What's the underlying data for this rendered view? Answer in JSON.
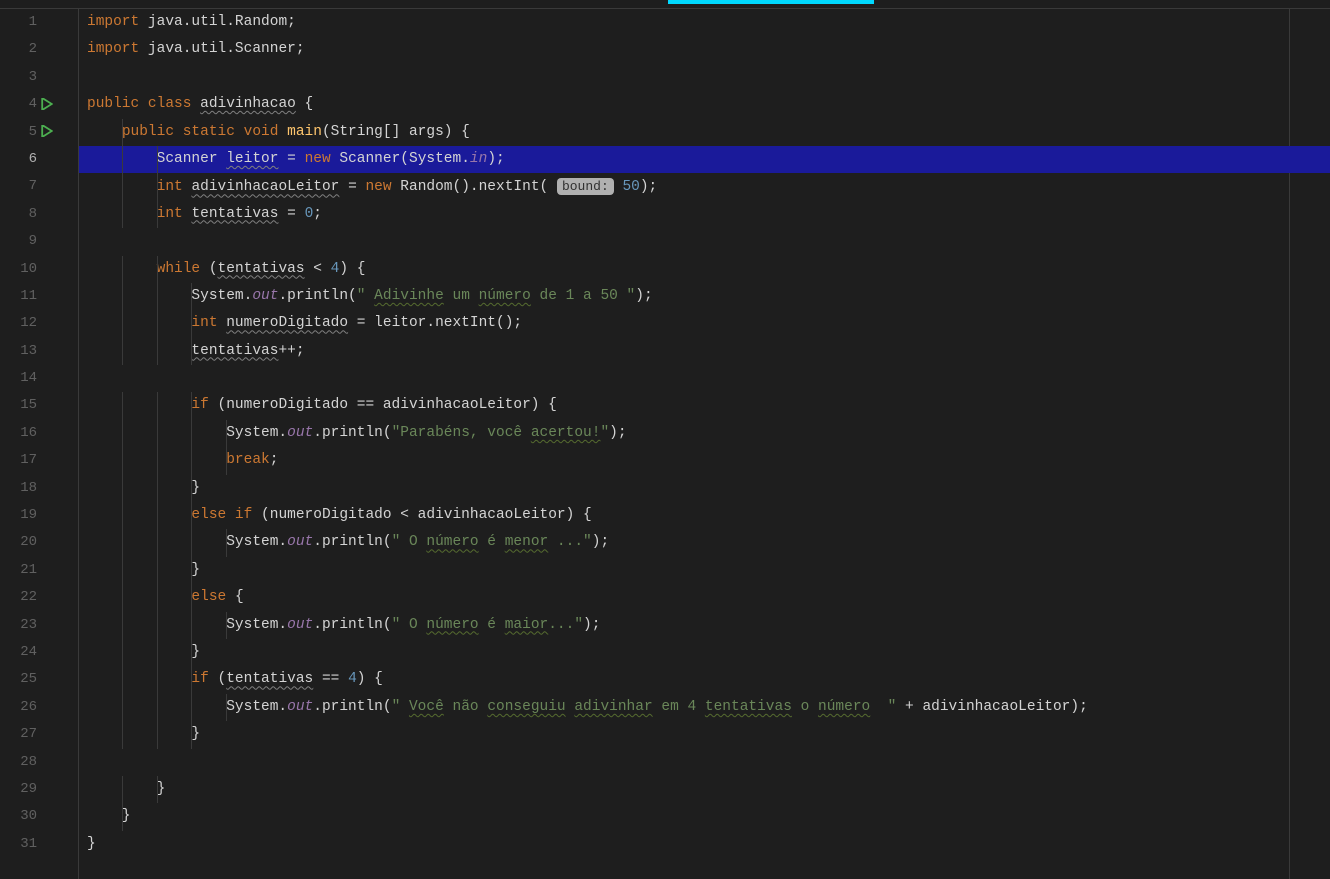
{
  "tabIndicatorColor": "#00d9ff",
  "highlightLine": 6,
  "runTriangles": [
    4,
    5
  ],
  "lines": [
    {
      "n": 1,
      "segs": [
        [
          "kw",
          "import "
        ],
        [
          "",
          "java.util.Random;"
        ]
      ]
    },
    {
      "n": 2,
      "segs": [
        [
          "kw",
          "import "
        ],
        [
          "",
          "java.util.Scanner;"
        ]
      ]
    },
    {
      "n": 3,
      "segs": []
    },
    {
      "n": 4,
      "segs": [
        [
          "kw",
          "public class "
        ],
        [
          "wavy",
          "adivinhacao"
        ],
        [
          "",
          " {"
        ]
      ]
    },
    {
      "n": 5,
      "segs": [
        [
          "",
          "    "
        ],
        [
          "kw",
          "public static void "
        ],
        [
          "mtd",
          "main"
        ],
        [
          "",
          "(String[] args) {"
        ]
      ]
    },
    {
      "n": 6,
      "segs": [
        [
          "",
          "        Scanner "
        ],
        [
          "wavy",
          "leitor"
        ],
        [
          "",
          " = "
        ],
        [
          "kw",
          "new "
        ],
        [
          "",
          "Scanner(System."
        ],
        [
          "fld",
          "in"
        ],
        [
          "",
          ");"
        ]
      ]
    },
    {
      "n": 7,
      "segs": [
        [
          "",
          "        "
        ],
        [
          "kw",
          "int "
        ],
        [
          "wavy",
          "adivinhacaoLeitor"
        ],
        [
          "",
          " = "
        ],
        [
          "kw",
          "new "
        ],
        [
          "",
          "Random().nextInt( "
        ],
        [
          "hint",
          "bound:"
        ],
        [
          "",
          " "
        ],
        [
          "num",
          "50"
        ],
        [
          "",
          ");"
        ]
      ]
    },
    {
      "n": 8,
      "segs": [
        [
          "",
          "        "
        ],
        [
          "kw",
          "int "
        ],
        [
          "wavy",
          "tentativas"
        ],
        [
          "",
          " = "
        ],
        [
          "num",
          "0"
        ],
        [
          "",
          ";"
        ]
      ]
    },
    {
      "n": 9,
      "segs": []
    },
    {
      "n": 10,
      "segs": [
        [
          "",
          "        "
        ],
        [
          "kw",
          "while "
        ],
        [
          "",
          "("
        ],
        [
          "wavy",
          "tentativas"
        ],
        [
          "",
          " < "
        ],
        [
          "num",
          "4"
        ],
        [
          "",
          ") {"
        ]
      ]
    },
    {
      "n": 11,
      "segs": [
        [
          "",
          "            System."
        ],
        [
          "fld",
          "out"
        ],
        [
          "",
          ".println("
        ],
        [
          "str",
          "\" "
        ],
        [
          "wavy-grn str",
          "Adivinhe"
        ],
        [
          "str",
          " um "
        ],
        [
          "wavy-grn str",
          "número"
        ],
        [
          "str",
          " de 1 a 50 \""
        ],
        [
          "",
          ");"
        ]
      ]
    },
    {
      "n": 12,
      "segs": [
        [
          "",
          "            "
        ],
        [
          "kw",
          "int "
        ],
        [
          "wavy",
          "numeroDigitado"
        ],
        [
          "",
          " = leitor.nextInt();"
        ]
      ]
    },
    {
      "n": 13,
      "segs": [
        [
          "",
          "            "
        ],
        [
          "wavy",
          "tentativas"
        ],
        [
          "",
          "++;"
        ]
      ]
    },
    {
      "n": 14,
      "segs": []
    },
    {
      "n": 15,
      "segs": [
        [
          "",
          "            "
        ],
        [
          "kw",
          "if "
        ],
        [
          "",
          "(numeroDigitado == adivinhacaoLeitor) {"
        ]
      ]
    },
    {
      "n": 16,
      "segs": [
        [
          "",
          "                System."
        ],
        [
          "fld",
          "out"
        ],
        [
          "",
          ".println("
        ],
        [
          "str",
          "\"Parabéns, você "
        ],
        [
          "wavy-grn str",
          "acertou!"
        ],
        [
          "str",
          "\""
        ],
        [
          "",
          ");"
        ]
      ]
    },
    {
      "n": 17,
      "segs": [
        [
          "",
          "                "
        ],
        [
          "kw",
          "break"
        ],
        [
          "",
          ";"
        ]
      ]
    },
    {
      "n": 18,
      "segs": [
        [
          "",
          "            }"
        ]
      ]
    },
    {
      "n": 19,
      "segs": [
        [
          "",
          "            "
        ],
        [
          "kw",
          "else if "
        ],
        [
          "",
          "(numeroDigitado < adivinhacaoLeitor) {"
        ]
      ]
    },
    {
      "n": 20,
      "segs": [
        [
          "",
          "                System."
        ],
        [
          "fld",
          "out"
        ],
        [
          "",
          ".println("
        ],
        [
          "str",
          "\" O "
        ],
        [
          "wavy-grn str",
          "número"
        ],
        [
          "str",
          " é "
        ],
        [
          "wavy-grn str",
          "menor"
        ],
        [
          "str",
          " ...\""
        ],
        [
          "",
          ");"
        ]
      ]
    },
    {
      "n": 21,
      "segs": [
        [
          "",
          "            }"
        ]
      ]
    },
    {
      "n": 22,
      "segs": [
        [
          "",
          "            "
        ],
        [
          "kw",
          "else "
        ],
        [
          "",
          "{"
        ]
      ]
    },
    {
      "n": 23,
      "segs": [
        [
          "",
          "                System."
        ],
        [
          "fld",
          "out"
        ],
        [
          "",
          ".println("
        ],
        [
          "str",
          "\" O "
        ],
        [
          "wavy-grn str",
          "número"
        ],
        [
          "str",
          " é "
        ],
        [
          "wavy-grn str",
          "maior"
        ],
        [
          "str",
          "...\""
        ],
        [
          "",
          ");"
        ]
      ]
    },
    {
      "n": 24,
      "segs": [
        [
          "",
          "            }"
        ]
      ]
    },
    {
      "n": 25,
      "segs": [
        [
          "",
          "            "
        ],
        [
          "kw",
          "if "
        ],
        [
          "",
          "("
        ],
        [
          "wavy",
          "tentativas"
        ],
        [
          "",
          " == "
        ],
        [
          "num",
          "4"
        ],
        [
          "",
          ") {"
        ]
      ]
    },
    {
      "n": 26,
      "segs": [
        [
          "",
          "                System."
        ],
        [
          "fld",
          "out"
        ],
        [
          "",
          ".println("
        ],
        [
          "str",
          "\" "
        ],
        [
          "wavy-grn str",
          "Você"
        ],
        [
          "str",
          " não "
        ],
        [
          "wavy-grn str",
          "conseguiu"
        ],
        [
          "str",
          " "
        ],
        [
          "wavy-grn str",
          "adivinhar"
        ],
        [
          "str",
          " em 4 "
        ],
        [
          "wavy-grn str",
          "tentativas"
        ],
        [
          "str",
          " o "
        ],
        [
          "wavy-grn str",
          "número"
        ],
        [
          "str",
          "  \""
        ],
        [
          "",
          " + adivinhacaoLeitor);"
        ]
      ]
    },
    {
      "n": 27,
      "segs": [
        [
          "",
          "            }"
        ]
      ]
    },
    {
      "n": 28,
      "segs": []
    },
    {
      "n": 29,
      "segs": [
        [
          "",
          "        }"
        ]
      ]
    },
    {
      "n": 30,
      "segs": [
        [
          "",
          "    }"
        ]
      ]
    },
    {
      "n": 31,
      "segs": [
        [
          "",
          "}"
        ]
      ]
    }
  ]
}
